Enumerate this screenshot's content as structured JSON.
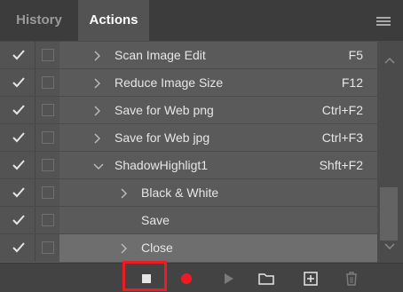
{
  "tabs": {
    "history": "History",
    "actions": "Actions"
  },
  "rows": [
    {
      "label": "Scan Image Edit",
      "shortcut": "F5",
      "arrow": "right",
      "level": 0,
      "selected": false
    },
    {
      "label": "Reduce Image Size",
      "shortcut": "F12",
      "arrow": "right",
      "level": 0,
      "selected": false
    },
    {
      "label": "Save for Web png",
      "shortcut": "Ctrl+F2",
      "arrow": "right",
      "level": 0,
      "selected": false
    },
    {
      "label": "Save for Web jpg",
      "shortcut": "Ctrl+F3",
      "arrow": "right",
      "level": 0,
      "selected": false
    },
    {
      "label": "ShadowHighligt1",
      "shortcut": "Shft+F2",
      "arrow": "down",
      "level": 0,
      "selected": false
    },
    {
      "label": "Black & White",
      "shortcut": "",
      "arrow": "right",
      "level": 1,
      "selected": false
    },
    {
      "label": "Save",
      "shortcut": "",
      "arrow": "none",
      "level": 1,
      "selected": false
    },
    {
      "label": "Close",
      "shortcut": "",
      "arrow": "right",
      "level": 1,
      "selected": true
    }
  ],
  "toolbar": {
    "buttons": [
      "stop-icon",
      "record-icon",
      "play-icon",
      "folder-icon",
      "new-action-icon",
      "trash-icon"
    ],
    "record_color": "#ee1b24",
    "highlight_color": "#ee1b24"
  }
}
